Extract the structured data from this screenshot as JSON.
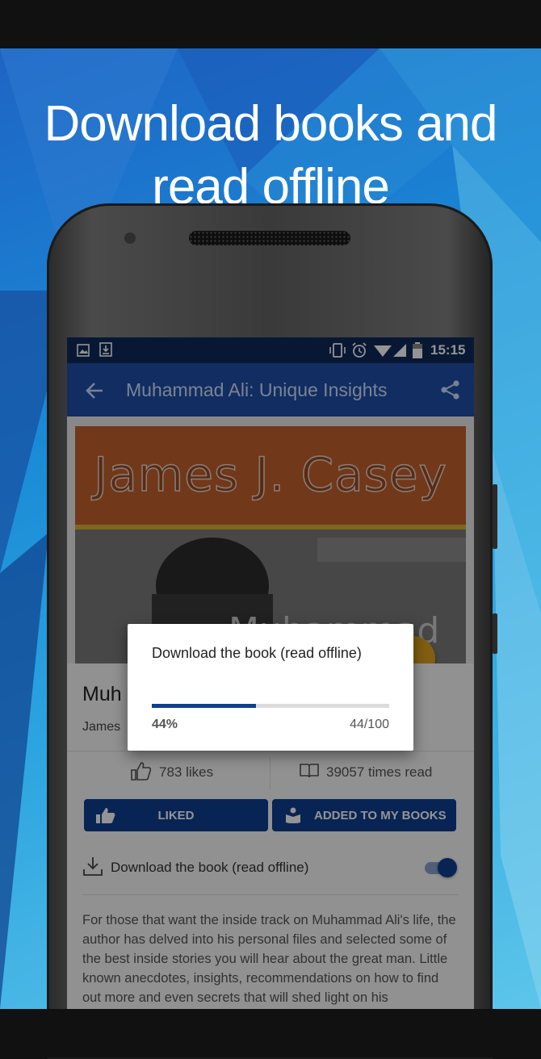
{
  "headline": {
    "line1": "Download books and",
    "line2": "read offline"
  },
  "status_bar": {
    "left_icons": [
      "image-icon",
      "download-icon"
    ],
    "right_icons": [
      "vibrate-icon",
      "alarm-icon",
      "wifi-icon",
      "signal-icon",
      "battery-icon"
    ],
    "time": "15:15"
  },
  "app_bar": {
    "back_icon": "arrow-left-icon",
    "title": "Muhammad Ali: Unique Insights",
    "share_icon": "share-icon"
  },
  "cover": {
    "author_text": "James J. Casey",
    "title_fragment": "Muhammad"
  },
  "book": {
    "title_fragment": "Muh",
    "author_fragment": "James"
  },
  "stats": {
    "likes": "783 likes",
    "times_read": "39057 times read"
  },
  "actions": {
    "liked_label": "LIKED",
    "added_label": "ADDED TO MY BOOKS"
  },
  "download_row": {
    "label": "Download the book (read offline)",
    "toggle_on": true
  },
  "description": "For those that want the inside track on Muhammad Ali's life, the author has delved into his personal files and selected some of the best inside stories you will hear about the great man. Little known anecdotes, insights, recommendations on how to find out more and even secrets that will shed light on his imperfections as well as his super-human like qualities.",
  "dialog": {
    "title": "Download the book (read offline)",
    "progress_fraction": 0.44,
    "percent_label": "44%",
    "count_label": "44/100"
  },
  "colors": {
    "app_bar": "#1e4fa8",
    "status_bar": "#0e2a5a",
    "button": "#0f3f91",
    "progress": "#0f3f91",
    "fab": "#e0a21e"
  }
}
